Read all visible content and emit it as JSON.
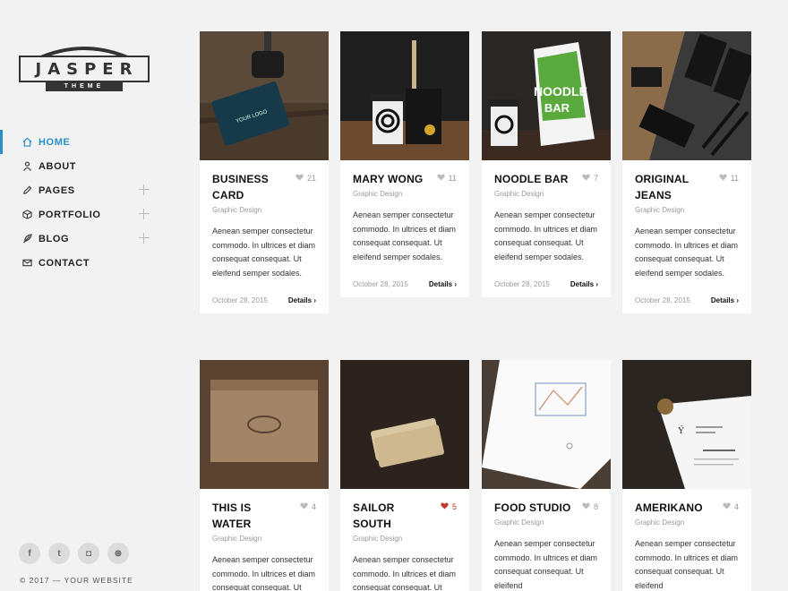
{
  "brand": {
    "name": "JASPER",
    "tagline": "THEME"
  },
  "nav": [
    {
      "label": "HOME",
      "icon": "home-icon",
      "active": true,
      "expandable": false
    },
    {
      "label": "ABOUT",
      "icon": "user-icon",
      "active": false,
      "expandable": false
    },
    {
      "label": "PAGES",
      "icon": "pencil-icon",
      "active": false,
      "expandable": true
    },
    {
      "label": "PORTFOLIO",
      "icon": "cube-icon",
      "active": false,
      "expandable": true
    },
    {
      "label": "BLOG",
      "icon": "feather-icon",
      "active": false,
      "expandable": true
    },
    {
      "label": "CONTACT",
      "icon": "envelope-icon",
      "active": false,
      "expandable": false
    }
  ],
  "socials": [
    {
      "icon": "facebook-icon",
      "glyph": "f"
    },
    {
      "icon": "twitter-icon",
      "glyph": "t"
    },
    {
      "icon": "instagram-icon",
      "glyph": "◘"
    },
    {
      "icon": "dribbble-icon",
      "glyph": "⊛"
    }
  ],
  "footer": {
    "copyright": "© 2017 — YOUR WEBSITE"
  },
  "accent_color": "#2b8fc9",
  "cards": [
    {
      "title_lines": [
        "BUSINESS",
        "CARD"
      ],
      "likes": "21",
      "liked": false,
      "category": "Graphic Design",
      "description": "Aenean semper consectetur commodo. In ultrices et diam consequat consequat. Ut eleifend semper sodales.",
      "date": "October 28, 2015",
      "details": "Details",
      "image": "business-card-photo"
    },
    {
      "title_lines": [
        "MARY WONG"
      ],
      "likes": "11",
      "liked": false,
      "category": "Graphic Design",
      "description": "Aenean semper consectetur commodo. In ultrices et diam consequat consequat. Ut eleifend semper sodales.",
      "date": "October 28, 2015",
      "details": "Details",
      "image": "cups-bag-photo"
    },
    {
      "title_lines": [
        "NOODLE BAR"
      ],
      "likes": "7",
      "liked": false,
      "category": "Graphic Design",
      "description": "Aenean semper consectetur commodo. In ultrices et diam consequat consequat. Ut eleifend semper sodales.",
      "date": "October 28, 2015",
      "details": "Details",
      "image": "noodle-bag-photo",
      "bag_text": [
        "NOODLE",
        "BAR"
      ]
    },
    {
      "title_lines": [
        "ORIGINAL",
        "JEANS"
      ],
      "likes": "11",
      "liked": false,
      "category": "Graphic Design",
      "description": "Aenean semper consectetur commodo. In ultrices et diam consequat consequat. Ut eleifend semper sodales.",
      "date": "October 28, 2015",
      "details": "Details",
      "image": "stationery-photo"
    },
    {
      "title_lines": [
        "THIS IS",
        "WATER"
      ],
      "likes": "4",
      "liked": false,
      "category": "Graphic Design",
      "description": "Aenean semper consectetur commodo. In ultrices et diam consequat consequat. Ut eleifend",
      "date": "",
      "details": "",
      "image": "kraft-box-photo"
    },
    {
      "title_lines": [
        "SAILOR",
        "SOUTH"
      ],
      "likes": "5",
      "liked": true,
      "category": "Graphic Design",
      "description": "Aenean semper consectetur commodo. In ultrices et diam consequat consequat. Ut eleifend",
      "date": "",
      "details": "",
      "image": "wood-cards-photo"
    },
    {
      "title_lines": [
        "FOOD STUDIO"
      ],
      "likes": "8",
      "liked": false,
      "category": "Graphic Design",
      "description": "Aenean semper consectetur commodo. In ultrices et diam consequat consequat. Ut eleifend",
      "date": "",
      "details": "",
      "image": "sketch-paper-photo"
    },
    {
      "title_lines": [
        "AMERIKANO"
      ],
      "likes": "4",
      "liked": false,
      "category": "Graphic Design",
      "description": "Aenean semper consectetur commodo. In ultrices et diam consequat consequat. Ut eleifend",
      "date": "",
      "details": "",
      "image": "letterhead-photo"
    }
  ]
}
